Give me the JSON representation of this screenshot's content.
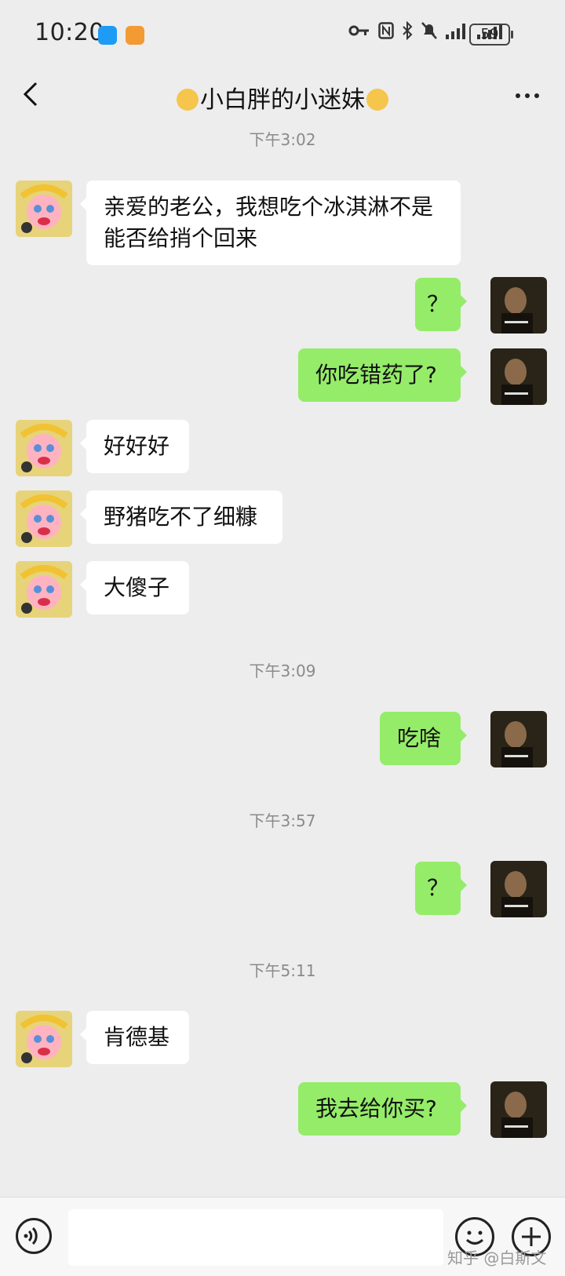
{
  "status": {
    "time": "10:20",
    "battery": "59"
  },
  "header": {
    "title": "小白胖的小迷妹"
  },
  "messages": [
    {
      "type": "time",
      "text": "下午3:02"
    },
    {
      "type": "in",
      "text": "亲爱的老公，我想吃个冰淇淋不是能否给捎个回来"
    },
    {
      "type": "out",
      "text": "？"
    },
    {
      "type": "out",
      "text": "你吃错药了?"
    },
    {
      "type": "in",
      "text": "好好好"
    },
    {
      "type": "in",
      "text": "野猪吃不了细糠"
    },
    {
      "type": "in",
      "text": "大傻子"
    },
    {
      "type": "time",
      "text": "下午3:09"
    },
    {
      "type": "out",
      "text": "吃啥"
    },
    {
      "type": "time",
      "text": "下午3:57"
    },
    {
      "type": "out",
      "text": "？"
    },
    {
      "type": "time",
      "text": "下午5:11"
    },
    {
      "type": "in",
      "text": "肯德基"
    },
    {
      "type": "out",
      "text": "我去给你买?"
    }
  ],
  "watermark": "知乎 @白斯文",
  "colors": {
    "background": "#ededed",
    "outgoing_bubble": "#95ec69",
    "incoming_bubble": "#ffffff"
  }
}
